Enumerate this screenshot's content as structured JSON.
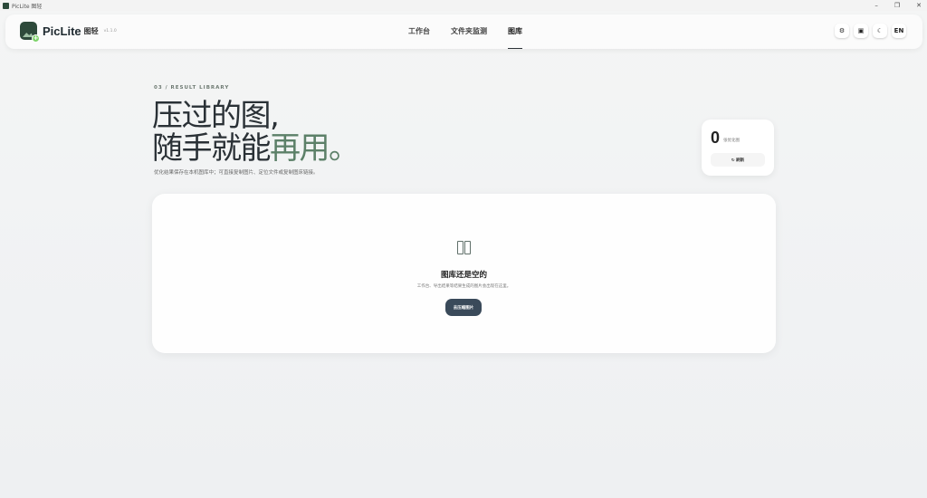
{
  "window": {
    "title": "PicLite 图轻",
    "controls": [
      "–",
      "❐",
      "✕"
    ]
  },
  "brand": {
    "name": "PicLite",
    "name_cn": "图轻",
    "version": "v1.1.0"
  },
  "nav": {
    "tabs": [
      {
        "label": "工作台",
        "active": false
      },
      {
        "label": "文件夹监测",
        "active": false
      },
      {
        "label": "图库",
        "active": true
      }
    ]
  },
  "toolbar": {
    "settings_icon": "⚙",
    "folder_icon": "▣",
    "theme_icon": "☾",
    "language": "EN"
  },
  "hero": {
    "eyebrow": "03 / RESULT LIBRARY",
    "line1": "压过的图,",
    "line2_plain": "随手就能",
    "line2_accent": "再用。",
    "subtitle": "优化结果保存在本机图库中；可直接复制图片、定位文件或复制图床链接。"
  },
  "stats": {
    "count": "0",
    "label": "张优化图",
    "refresh_label": "↻ 刷新"
  },
  "empty_state": {
    "icon": "book-open-icon",
    "title": "图库还是空的",
    "description": "工作台、导出结果等结果生成的图片会出现在这里。",
    "button_label": "去压缩图片"
  }
}
